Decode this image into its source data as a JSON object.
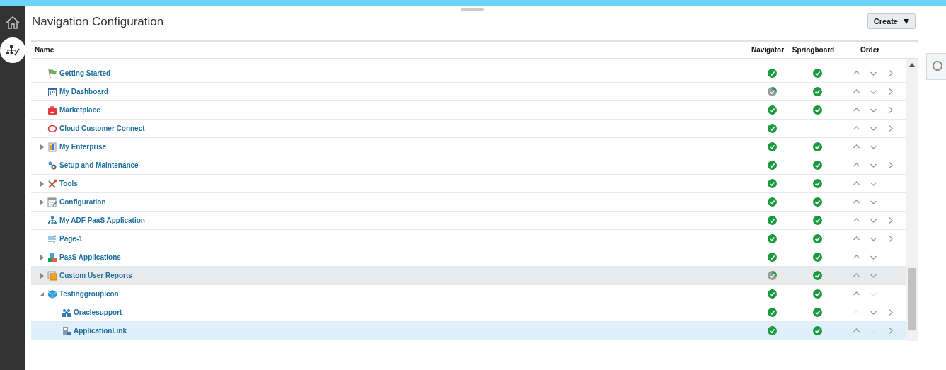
{
  "page": {
    "title": "Navigation Configuration",
    "create_button": "Create"
  },
  "table": {
    "columns": [
      "Name",
      "Navigator",
      "Springboard",
      "Order"
    ],
    "rows": [
      {
        "name": "Getting Started",
        "kind": "flag",
        "in_navigator": true,
        "navigator_partial": false,
        "in_springboard": true,
        "up_disabled": false,
        "down_disabled": false,
        "move_right": true,
        "hovered": false,
        "selected": false
      },
      {
        "name": "My Dashboard",
        "kind": "dashboard",
        "in_navigator": true,
        "navigator_partial": true,
        "in_springboard": true,
        "up_disabled": false,
        "down_disabled": false,
        "move_right": true,
        "hovered": false,
        "selected": false
      },
      {
        "name": "Marketplace",
        "kind": "bag",
        "in_navigator": true,
        "navigator_partial": false,
        "in_springboard": true,
        "up_disabled": false,
        "down_disabled": false,
        "move_right": true,
        "hovered": false,
        "selected": false
      },
      {
        "name": "Cloud Customer Connect",
        "kind": "ring",
        "in_navigator": true,
        "navigator_partial": false,
        "in_springboard": false,
        "up_disabled": false,
        "down_disabled": false,
        "move_right": true,
        "hovered": false,
        "selected": false
      },
      {
        "name": "My Enterprise",
        "kind": "building",
        "expanded": false,
        "in_navigator": true,
        "navigator_partial": false,
        "in_springboard": true,
        "up_disabled": false,
        "down_disabled": false,
        "move_right": false,
        "hovered": false,
        "selected": false
      },
      {
        "name": "Setup and Maintenance",
        "kind": "gears",
        "in_navigator": true,
        "navigator_partial": false,
        "in_springboard": true,
        "up_disabled": false,
        "down_disabled": false,
        "move_right": true,
        "hovered": false,
        "selected": false
      },
      {
        "name": "Tools",
        "kind": "tools",
        "expanded": false,
        "in_navigator": true,
        "navigator_partial": false,
        "in_springboard": true,
        "up_disabled": false,
        "down_disabled": false,
        "move_right": false,
        "hovered": false,
        "selected": false
      },
      {
        "name": "Configuration",
        "kind": "config",
        "expanded": false,
        "in_navigator": true,
        "navigator_partial": false,
        "in_springboard": true,
        "up_disabled": false,
        "down_disabled": false,
        "move_right": false,
        "hovered": false,
        "selected": false
      },
      {
        "name": "My ADF PaaS Application",
        "kind": "hierarchy",
        "in_navigator": true,
        "navigator_partial": false,
        "in_springboard": true,
        "up_disabled": false,
        "down_disabled": false,
        "move_right": true,
        "hovered": false,
        "selected": false
      },
      {
        "name": "Page-1",
        "kind": "wind",
        "in_navigator": true,
        "navigator_partial": false,
        "in_springboard": true,
        "up_disabled": false,
        "down_disabled": false,
        "move_right": true,
        "hovered": false,
        "selected": false
      },
      {
        "name": "PaaS Applications",
        "kind": "blocks",
        "expanded": false,
        "in_navigator": true,
        "navigator_partial": false,
        "in_springboard": true,
        "up_disabled": false,
        "down_disabled": false,
        "move_right": false,
        "hovered": false,
        "selected": false
      },
      {
        "name": "Custom User Reports",
        "kind": "reports",
        "expanded": false,
        "in_navigator": true,
        "navigator_partial": true,
        "in_springboard": true,
        "up_disabled": false,
        "down_disabled": false,
        "move_right": false,
        "hovered": true,
        "selected": false
      },
      {
        "name": "Testinggroupicon",
        "kind": "cube",
        "expanded": true,
        "in_navigator": true,
        "navigator_partial": false,
        "in_springboard": true,
        "up_disabled": false,
        "down_disabled": true,
        "move_right": false,
        "hovered": false,
        "selected": false,
        "children": [
          {
            "name": "Oraclesupport",
            "kind": "people",
            "in_navigator": true,
            "navigator_partial": false,
            "in_springboard": true,
            "up_disabled": true,
            "down_disabled": false,
            "move_right": true,
            "hovered": false,
            "selected": false
          },
          {
            "name": "ApplicationLink",
            "kind": "device",
            "in_navigator": true,
            "navigator_partial": false,
            "in_springboard": true,
            "up_disabled": false,
            "down_disabled": true,
            "move_right": true,
            "hovered": false,
            "selected": true
          }
        ]
      }
    ]
  }
}
